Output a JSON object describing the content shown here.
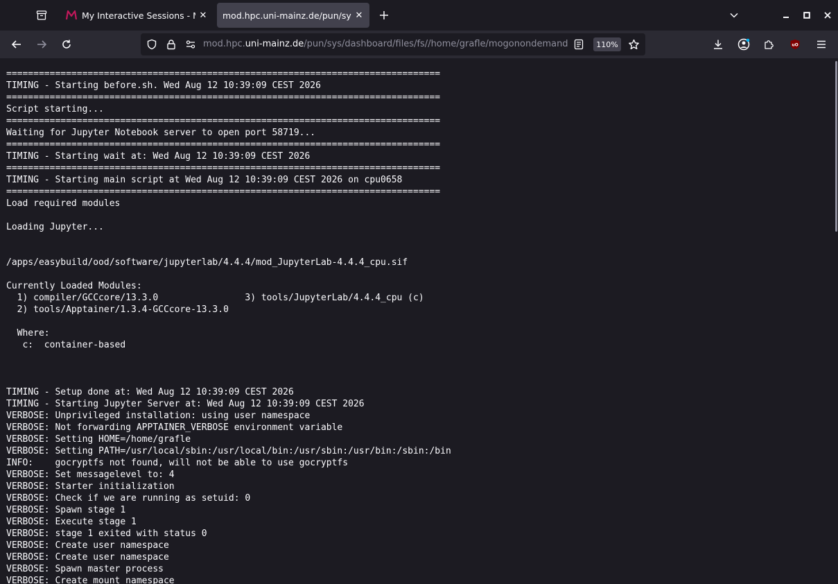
{
  "tabs": [
    {
      "title": "My Interactive Sessions - MOG",
      "active": false
    },
    {
      "title": "mod.hpc.uni-mainz.de/pun/sys/dashboard",
      "active": true
    }
  ],
  "url": {
    "prefix": "mod.hpc.",
    "host": "uni-mainz.de",
    "path": "/pun/sys/dashboard/files/fs//home/grafle/mogonondemand/data/"
  },
  "zoom": "110%",
  "icons": {
    "tab_manager": "archive-icon",
    "new_tab": "plus-icon",
    "list_tabs": "chevron-down-icon",
    "back": "arrow-left-icon",
    "forward": "arrow-right-icon",
    "reload": "reload-icon",
    "shield": "shield-icon",
    "lock": "lock-icon",
    "permissions": "permissions-icon",
    "reader": "reader-view-icon",
    "bookmark": "star-icon",
    "downloads": "download-icon",
    "account": "account-icon",
    "extensions": "puzzle-icon",
    "ublock": "ublock-icon",
    "menu": "hamburger-menu-icon"
  },
  "colors": {
    "tab_favicon": "#c2185b",
    "ublock": "#800000"
  },
  "log_lines": [
    "================================================================================",
    "TIMING - Starting before.sh. Wed Aug 12 10:39:09 CEST 2026",
    "================================================================================",
    "Script starting...",
    "================================================================================",
    "Waiting for Jupyter Notebook server to open port 58719...",
    "================================================================================",
    "TIMING - Starting wait at: Wed Aug 12 10:39:09 CEST 2026",
    "================================================================================",
    "TIMING - Starting main script at Wed Aug 12 10:39:09 CEST 2026 on cpu0658",
    "================================================================================",
    "Load required modules",
    "",
    "Loading Jupyter...",
    "",
    "",
    "/apps/easybuild/ood/software/jupyterlab/4.4.4/mod_JupyterLab-4.4.4_cpu.sif",
    "",
    "Currently Loaded Modules:",
    "  1) compiler/GCCcore/13.3.0                3) tools/JupyterLab/4.4.4_cpu (c)",
    "  2) tools/Apptainer/1.3.4-GCCcore-13.3.0",
    "",
    "  Where:",
    "   c:  container-based",
    "",
    "",
    "",
    "TIMING - Setup done at: Wed Aug 12 10:39:09 CEST 2026",
    "TIMING - Starting Jupyter Server at: Wed Aug 12 10:39:09 CEST 2026",
    "VERBOSE: Unprivileged installation: using user namespace",
    "VERBOSE: Not forwarding APPTAINER_VERBOSE environment variable",
    "VERBOSE: Setting HOME=/home/grafle",
    "VERBOSE: Setting PATH=/usr/local/sbin:/usr/local/bin:/usr/sbin:/usr/bin:/sbin:/bin",
    "INFO:    gocryptfs not found, will not be able to use gocryptfs",
    "VERBOSE: Set messagelevel to: 4",
    "VERBOSE: Starter initialization",
    "VERBOSE: Check if we are running as setuid: 0",
    "VERBOSE: Spawn stage 1",
    "VERBOSE: Execute stage 1",
    "VERBOSE: stage 1 exited with status 0",
    "VERBOSE: Create user namespace",
    "VERBOSE: Create user namespace",
    "VERBOSE: Spawn master process",
    "VERBOSE: Create mount namespace"
  ]
}
